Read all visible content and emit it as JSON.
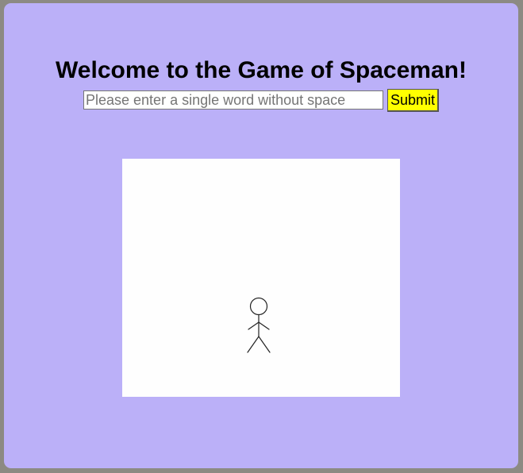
{
  "game": {
    "title": "Welcome to the Game of Spaceman!",
    "word_input_value": "",
    "word_input_placeholder": "Please enter a single word without space",
    "submit_label": "Submit"
  },
  "colors": {
    "page_frame": "#8c8a83",
    "panel_background": "#bbb0f8",
    "submit_button": "#ffff00",
    "canvas_background": "#fefefe",
    "figure_stroke": "#222222"
  },
  "icons": {
    "figure": "stick-figure-icon"
  }
}
